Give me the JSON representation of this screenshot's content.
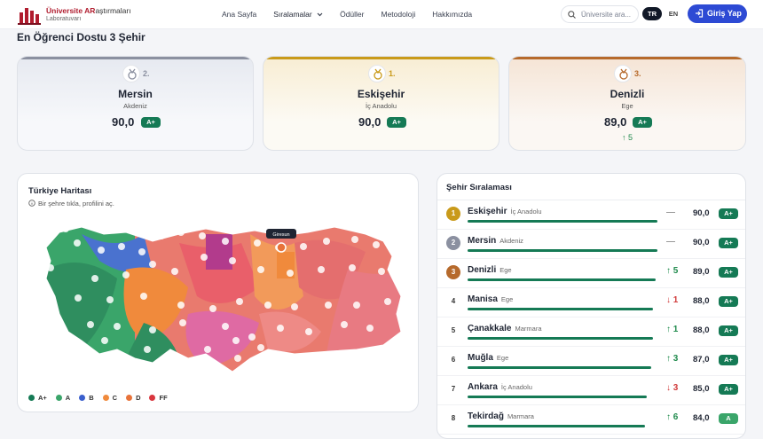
{
  "nav": {
    "logo_line1_a": "Üniversite AR",
    "logo_line1_b": "aştırmaları",
    "logo_line2": "Laboratuvarı",
    "menu": [
      "Ana Sayfa",
      "Sıralamalar",
      "Ödüller",
      "Metodoloji",
      "Hakkımızda"
    ],
    "search_placeholder": "Üniversite ara...",
    "lang_active": "TR",
    "lang_other": "EN",
    "login": "Giriş Yap"
  },
  "top3_title": "En Öğrenci Dostu 3 Şehir",
  "top3": [
    {
      "rank": "2.",
      "name": "Mersin",
      "region": "Akdeniz",
      "score": "90,0",
      "grade": "A+",
      "change": "",
      "accent": "#8b90a0"
    },
    {
      "rank": "1.",
      "name": "Eskişehir",
      "region": "İç Anadolu",
      "score": "90,0",
      "grade": "A+",
      "change": "",
      "accent": "#c99a1a"
    },
    {
      "rank": "3.",
      "name": "Denizli",
      "region": "Ege",
      "score": "89,0",
      "grade": "A+",
      "change": "5",
      "accent": "#b66a2c"
    }
  ],
  "map": {
    "title": "Türkiye Haritası",
    "hint": "Bir şehre tıkla, profilini aç.",
    "tooltip": "Giresun",
    "legend": [
      {
        "label": "A+",
        "color": "#157a55"
      },
      {
        "label": "A",
        "color": "#3aa56a"
      },
      {
        "label": "B",
        "color": "#3a5fcd"
      },
      {
        "label": "C",
        "color": "#f08a3c"
      },
      {
        "label": "D",
        "color": "#e8733a"
      },
      {
        "label": "FF",
        "color": "#d9363e"
      }
    ]
  },
  "ranking": {
    "title": "Şehir Sıralaması",
    "rows": [
      {
        "rank": "1",
        "name": "Eskişehir",
        "region": "İç Anadolu",
        "trend": "—",
        "dir": "flat",
        "score": "90,0",
        "grade": "A+",
        "bar": 0.9
      },
      {
        "rank": "2",
        "name": "Mersin",
        "region": "Akdeniz",
        "trend": "—",
        "dir": "flat",
        "score": "90,0",
        "grade": "A+",
        "bar": 0.9
      },
      {
        "rank": "3",
        "name": "Denizli",
        "region": "Ege",
        "trend": "↑ 5",
        "dir": "up",
        "score": "89,0",
        "grade": "A+",
        "bar": 0.89
      },
      {
        "rank": "4",
        "name": "Manisa",
        "region": "Ege",
        "trend": "↓ 1",
        "dir": "down",
        "score": "88,0",
        "grade": "A+",
        "bar": 0.88
      },
      {
        "rank": "5",
        "name": "Çanakkale",
        "region": "Marmara",
        "trend": "↑ 1",
        "dir": "up",
        "score": "88,0",
        "grade": "A+",
        "bar": 0.88
      },
      {
        "rank": "6",
        "name": "Muğla",
        "region": "Ege",
        "trend": "↑ 3",
        "dir": "up",
        "score": "87,0",
        "grade": "A+",
        "bar": 0.87
      },
      {
        "rank": "7",
        "name": "Ankara",
        "region": "İç Anadolu",
        "trend": "↓ 3",
        "dir": "down",
        "score": "85,0",
        "grade": "A+",
        "bar": 0.85
      },
      {
        "rank": "8",
        "name": "Tekirdağ",
        "region": "Marmara",
        "trend": "↑ 6",
        "dir": "up",
        "score": "84,0",
        "grade": "A",
        "bar": 0.84
      }
    ]
  }
}
